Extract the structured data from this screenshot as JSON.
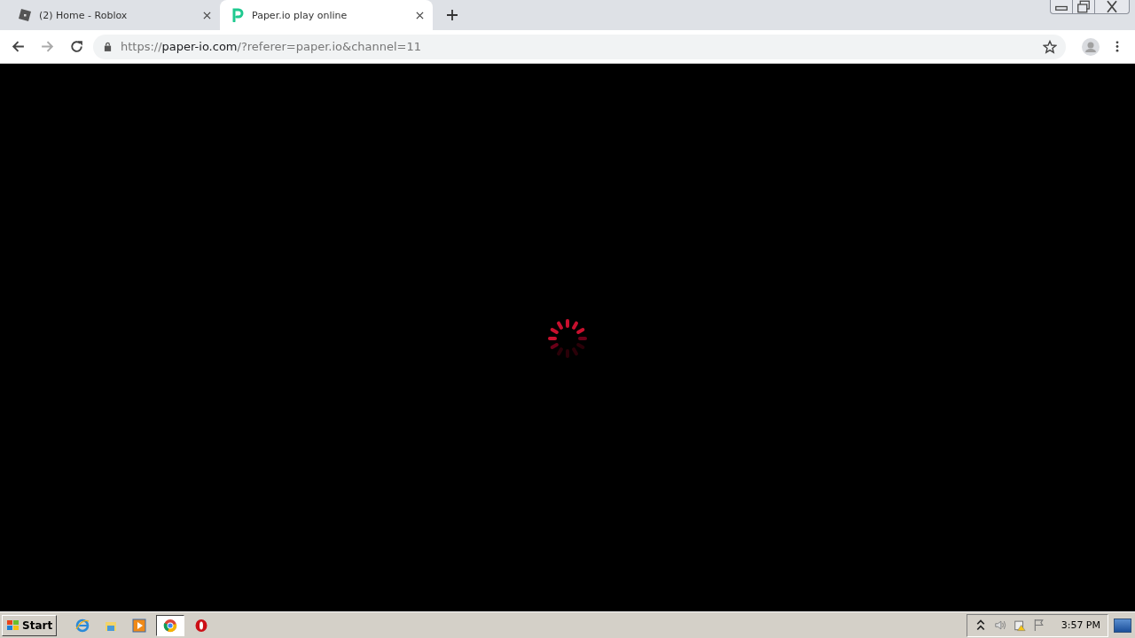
{
  "tabs": [
    {
      "title": "(2) Home - Roblox",
      "kind": "roblox",
      "selected": false
    },
    {
      "title": "Paper.io play online",
      "kind": "paperio",
      "selected": true
    }
  ],
  "address_bar": {
    "scheme": "https://",
    "host": "paper-io.com",
    "path": "/?referer=paper.io&channel=11"
  },
  "taskbar": {
    "start": "Start",
    "apps": [
      {
        "kind": "ie",
        "selected": false
      },
      {
        "kind": "explorer",
        "selected": false
      },
      {
        "kind": "media",
        "selected": false
      },
      {
        "kind": "chrome",
        "selected": true
      },
      {
        "kind": "opera",
        "selected": false
      }
    ],
    "clock": "3:57 PM"
  }
}
